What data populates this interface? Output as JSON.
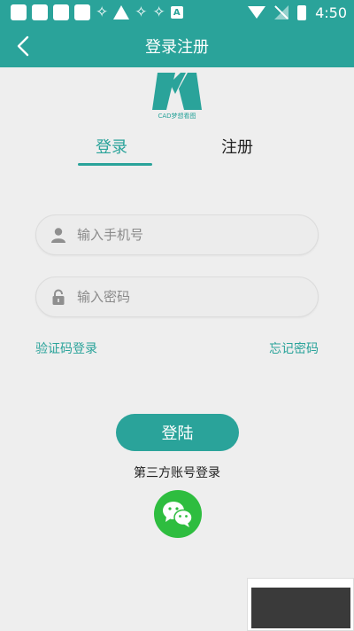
{
  "status_bar": {
    "time": "4:50"
  },
  "header": {
    "title": "登录注册"
  },
  "logo": {
    "text": "CAD梦想看图"
  },
  "tabs": [
    {
      "label": "登录",
      "active": true
    },
    {
      "label": "注册",
      "active": false
    }
  ],
  "form": {
    "phone_placeholder": "输入手机号",
    "password_placeholder": "输入密码"
  },
  "links": {
    "sms_login": "验证码登录",
    "forgot_password": "忘记密码"
  },
  "login_button": "登陆",
  "third_party_label": "第三方账号登录",
  "colors": {
    "primary": "#2aa39a",
    "wechat": "#2ebd3f",
    "background": "#eeeeee"
  },
  "icons": [
    "back-arrow-icon",
    "user-icon",
    "lock-icon",
    "wechat-icon"
  ]
}
